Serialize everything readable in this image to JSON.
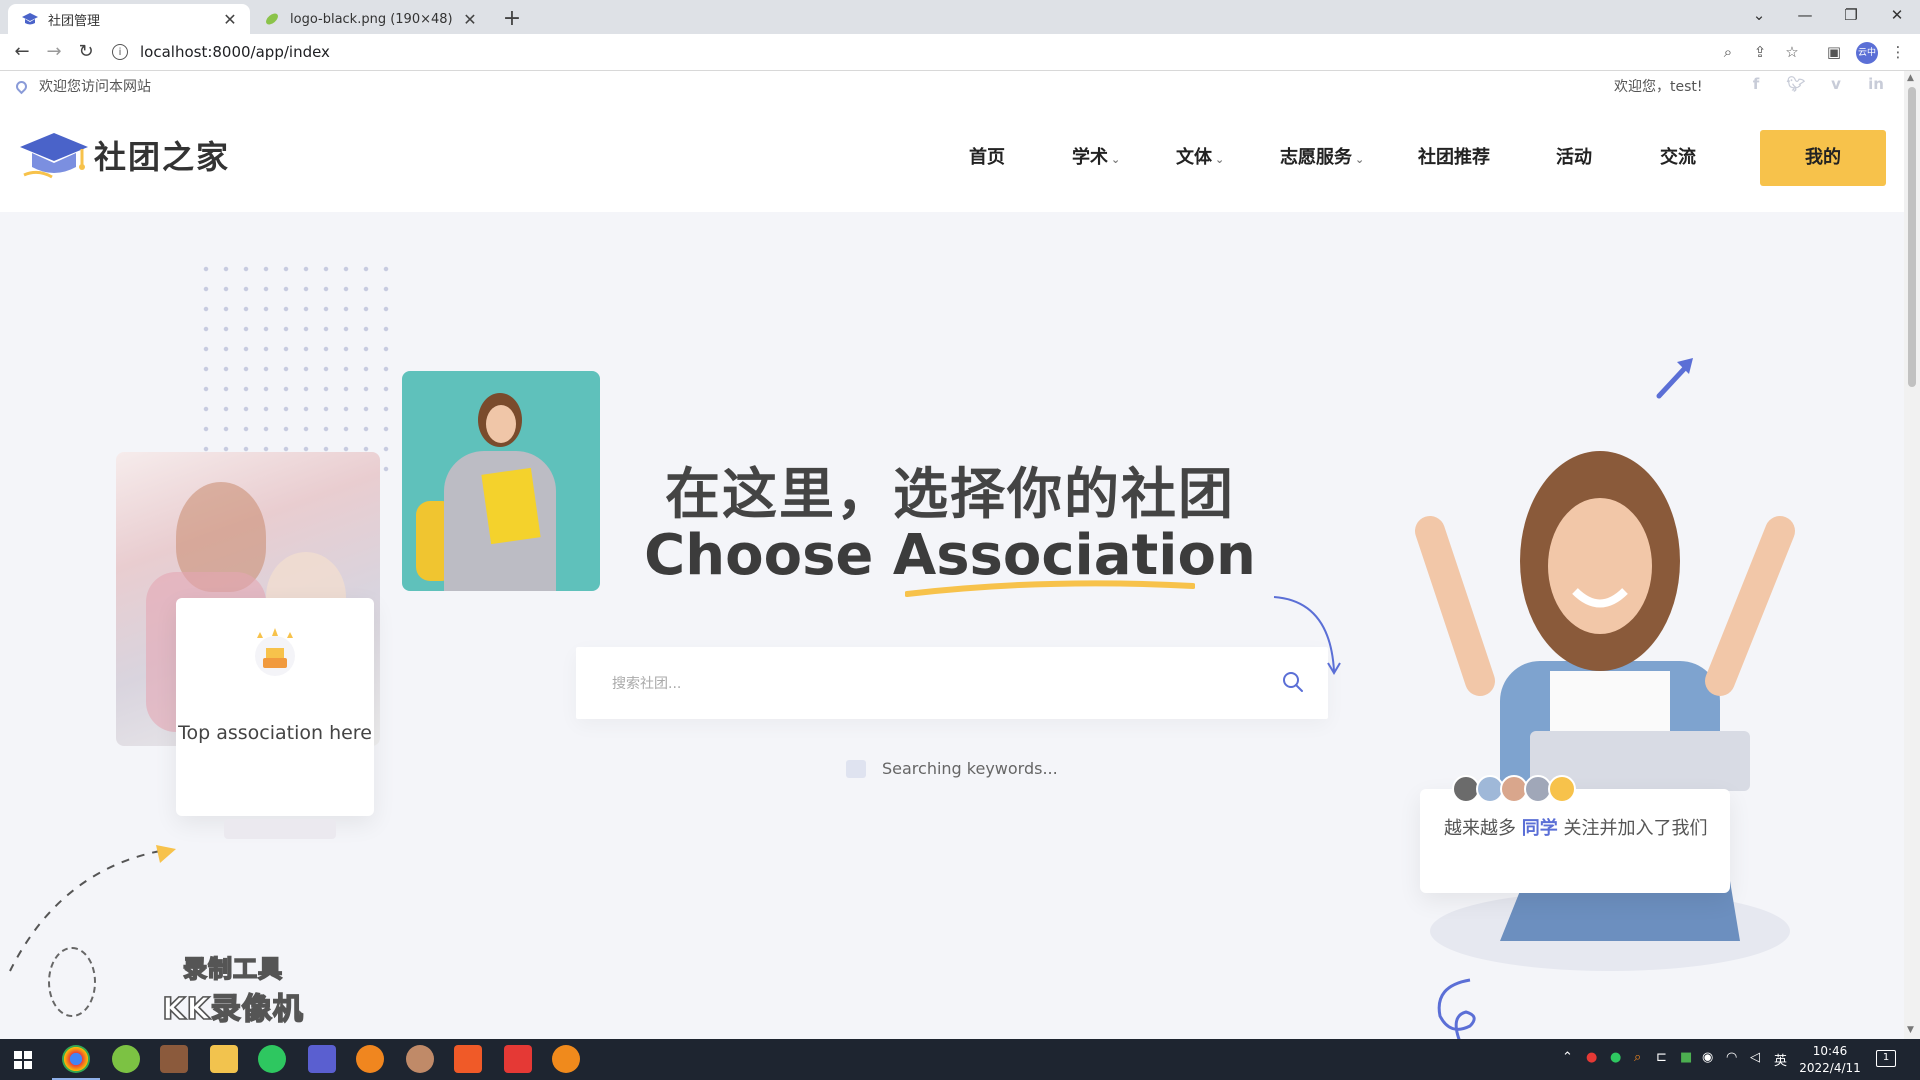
{
  "browser": {
    "tabs": [
      {
        "title": "社团管理",
        "active": true
      },
      {
        "title": "logo-black.png (190×48)",
        "active": false
      }
    ],
    "url": "localhost:8000/app/index",
    "profile_badge": "云中"
  },
  "site": {
    "topbar": {
      "location_text": "欢迎您访问本网站",
      "welcome_text": "欢迎您，test!",
      "social_icons": [
        "facebook-icon",
        "twitter-icon",
        "vimeo-icon",
        "linkedin-icon"
      ]
    },
    "logo_text": "社团之家",
    "nav": {
      "items": [
        {
          "label": "首页",
          "has_dropdown": false
        },
        {
          "label": "学术",
          "has_dropdown": true
        },
        {
          "label": "文体",
          "has_dropdown": true
        },
        {
          "label": "志愿服务",
          "has_dropdown": true
        },
        {
          "label": "社团推荐",
          "has_dropdown": false
        },
        {
          "label": "活动",
          "has_dropdown": false
        },
        {
          "label": "交流",
          "has_dropdown": false
        }
      ],
      "mine_button": "我的",
      "chevron": "⌄"
    },
    "hero": {
      "title_cn": "在这里，选择你的社团",
      "title_en": "Choose Association",
      "search_placeholder": "搜索社团...",
      "searching_text": "Searching keywords...",
      "top_card_text": "Top association here",
      "join_card": {
        "prefix": "越来越多",
        "highlight": "同学",
        "suffix": "关注并加入了我们"
      }
    },
    "watermark": {
      "line1": "录制工具",
      "line2": "KK录像机"
    }
  },
  "taskbar": {
    "time": "10:46",
    "date": "2022/4/11",
    "ime": "英",
    "notification_count": "1"
  },
  "colors": {
    "accent_yellow": "#f7c24b",
    "accent_blue": "#5b6fd6",
    "page_bg": "#f4f5f9"
  }
}
